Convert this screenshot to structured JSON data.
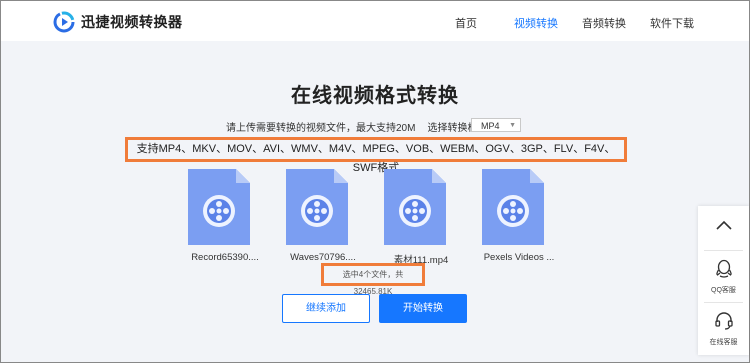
{
  "header": {
    "brand": "迅捷视频转换器",
    "nav": [
      "首页",
      "视频转换",
      "音频转换",
      "软件下载"
    ],
    "active_nav_index": 1,
    "accent_color": "#1677ff"
  },
  "main": {
    "title": "在线视频格式转换",
    "upload_hint": "请上传需要转换的视频文件，最大支持20M",
    "select_label": "选择转换格式:",
    "selected_format": "MP4",
    "supported_formats": "支持MP4、MKV、MOV、AVI、WMV、M4V、MPEG、VOB、WEBM、OGV、3GP、FLV、F4V、SWF格式",
    "files": [
      {
        "name": "Record65390....",
        "icon": "video-file-icon"
      },
      {
        "name": "Waves70796....",
        "icon": "video-file-icon"
      },
      {
        "name": "素材111.mp4",
        "icon": "video-file-icon"
      },
      {
        "name": "Pexels Videos ...",
        "icon": "video-file-icon"
      }
    ],
    "summary": "选中4个文件，共32465.81K",
    "continue_button": "继续添加",
    "start_button": "开始转换",
    "highlight_color": "#f07c3a"
  },
  "side": {
    "qq_label": "QQ客服",
    "online_label": "在线客服",
    "up_icon": "chevron-up-icon"
  }
}
